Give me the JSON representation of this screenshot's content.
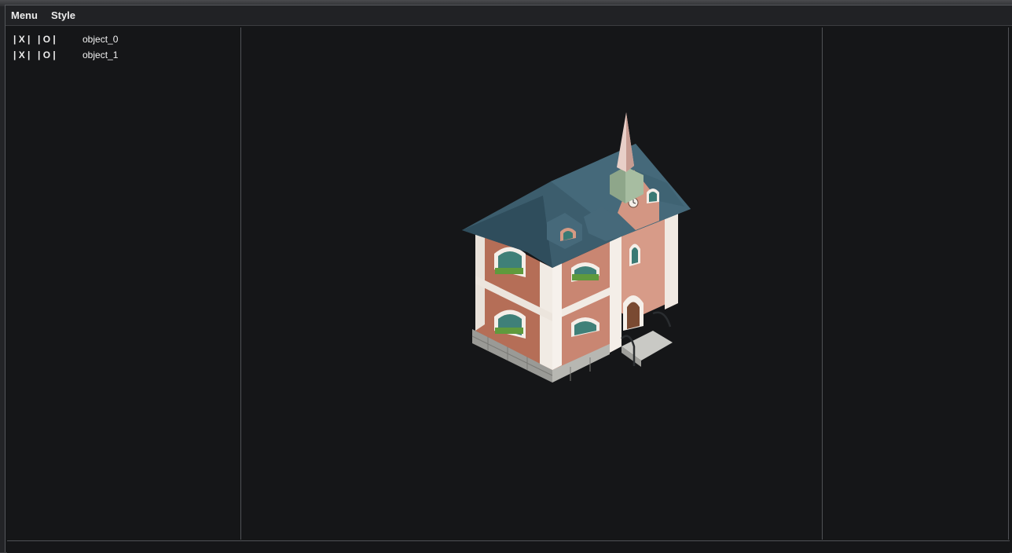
{
  "menubar": {
    "items": [
      {
        "label": "Menu"
      },
      {
        "label": "Style"
      }
    ]
  },
  "object_list": {
    "rows": [
      {
        "visibility_toggle": "| X |",
        "outline_toggle": "| O |",
        "name": "object_0"
      },
      {
        "visibility_toggle": "| X |",
        "outline_toggle": "| O |",
        "name": "object_1"
      }
    ]
  },
  "viewport": {
    "model": "church-building",
    "background_color": "#151618"
  }
}
